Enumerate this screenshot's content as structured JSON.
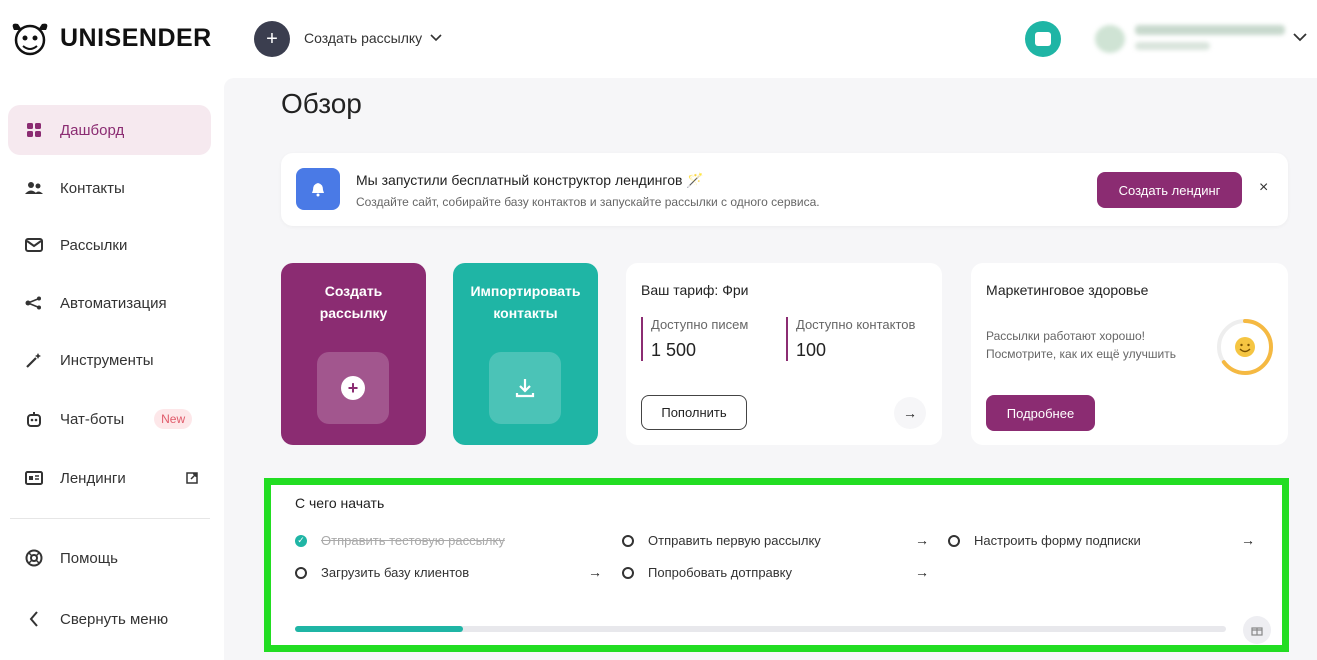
{
  "header": {
    "logo_text": "UNISENDER",
    "create_plus": "+",
    "create_label": "Создать рассылку",
    "chevron": "⌄"
  },
  "sidebar": {
    "items": [
      {
        "label": "Дашборд",
        "icon": "dashboard-icon",
        "active": true
      },
      {
        "label": "Контакты",
        "icon": "contacts-icon"
      },
      {
        "label": "Рассылки",
        "icon": "mail-icon"
      },
      {
        "label": "Автоматизация",
        "icon": "automation-icon"
      },
      {
        "label": "Инструменты",
        "icon": "magic-wand-icon"
      },
      {
        "label": "Чат-боты",
        "icon": "bot-icon",
        "badge": "New"
      },
      {
        "label": "Лендинги",
        "icon": "landing-icon"
      },
      {
        "label": "Помощь",
        "icon": "help-icon"
      },
      {
        "label": "Свернуть меню",
        "icon": "chevron-left-icon"
      }
    ]
  },
  "main": {
    "title": "Обзор",
    "banner": {
      "title": "Мы запустили бесплатный конструктор лендингов 🪄",
      "subtitle": "Создайте сайт, собирайте базу контактов и запускайте рассылки с одного сервиса.",
      "button": "Создать лендинг",
      "close": "×"
    },
    "card_send": {
      "title": "Создать рассылку"
    },
    "card_import": {
      "title": "Импортировать контакты"
    },
    "tariff": {
      "title": "Ваш тариф: Фри",
      "letters_label": "Доступно писем",
      "letters_value": "1 500",
      "contacts_label": "Доступно контактов",
      "contacts_value": "100",
      "button": "Пополнить",
      "arrow": "→"
    },
    "health": {
      "title": "Маркетинговое здоровье",
      "text_line1": "Рассылки работают хорошо!",
      "text_line2": "Посмотрите, как их ещё улучшить",
      "button": "Подробнее",
      "score_fraction": 0.65
    },
    "start": {
      "title": "С чего начать",
      "tasks": [
        {
          "label": "Отправить тестовую рассылку",
          "done": true
        },
        {
          "label": "Отправить первую рассылку",
          "done": false
        },
        {
          "label": "Настроить форму подписки",
          "done": false
        },
        {
          "label": "Загрузить базу клиентов",
          "done": false
        },
        {
          "label": "Попробовать дотправку",
          "done": false
        }
      ],
      "arrow": "→",
      "progress": 0.18
    }
  },
  "colors": {
    "brand": "#8b2c72",
    "teal": "#1fb5a5",
    "highlight": "#22dd22"
  }
}
